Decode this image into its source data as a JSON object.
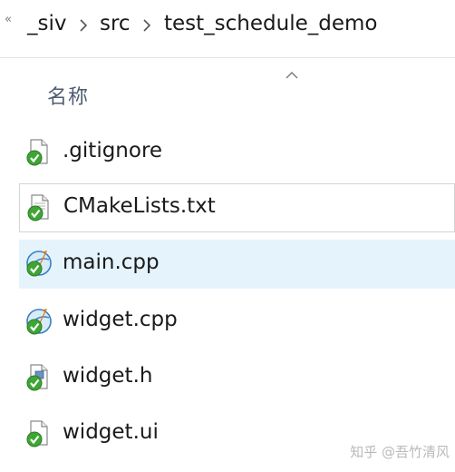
{
  "breadcrumb": {
    "overflow_glyph": "«",
    "segments": [
      "_siv",
      "src",
      "test_schedule_demo"
    ],
    "separator_icon": "chevron-right-icon"
  },
  "header": {
    "sort_indicator_icon": "chevron-up-icon",
    "name_column": "名称"
  },
  "files": [
    {
      "name": ".gitignore",
      "icon": "file-icon-synced",
      "state": "normal"
    },
    {
      "name": "CMakeLists.txt",
      "icon": "text-file-icon-synced",
      "state": "focused"
    },
    {
      "name": "main.cpp",
      "icon": "cpp-file-icon-synced",
      "state": "selected"
    },
    {
      "name": "widget.cpp",
      "icon": "cpp-file-icon-synced",
      "state": "normal"
    },
    {
      "name": "widget.h",
      "icon": "header-file-icon-synced",
      "state": "normal"
    },
    {
      "name": "widget.ui",
      "icon": "file-icon-synced",
      "state": "normal"
    }
  ],
  "watermark": "知乎 @吾竹清风",
  "colors": {
    "selected_row_bg": "#e5f3fc",
    "focus_border": "#d4d4d4",
    "sync_check_green": "#3fa535",
    "header_text": "#4d5c70"
  }
}
